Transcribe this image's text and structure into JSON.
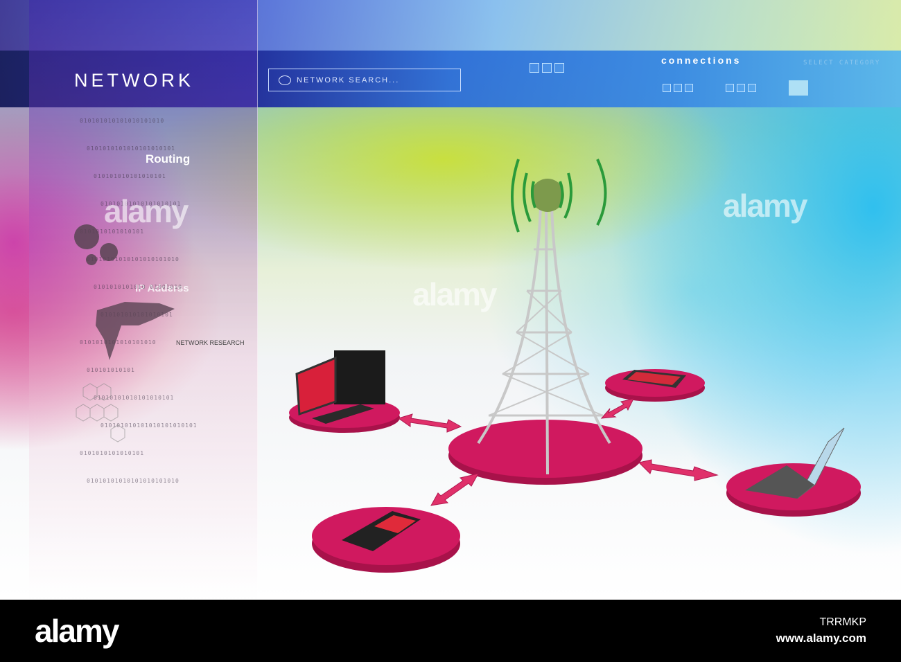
{
  "header": {
    "title": "NETWORK",
    "search_placeholder": "NETWORK SEARCH...",
    "connections_label": "connections",
    "select_category_label": "SELECT CATEGORY"
  },
  "sidebar": {
    "routing_label": "Routing",
    "ip_label": "IP Adderss",
    "research_label": "NETWORK RESEARCH",
    "binary": [
      "010101010101010101010",
      "0101010101010101010101",
      "010101010101010101",
      "01010101010101010101",
      "0101010101010101",
      "01010101010101010101010",
      "0101010101010 01001010",
      "010101010101010101",
      "0101010101010101010",
      "010101010101",
      "01010101010101010101",
      "010101010101010101010101",
      "0101010101010101",
      "01010101010101010101010"
    ]
  },
  "scene": {
    "nodes": [
      "computer",
      "tablet",
      "laptop",
      "mobile-phone"
    ],
    "hub": "cell-tower",
    "disc_color": "#d0195f",
    "arrow_color": "#e0306a"
  },
  "watermark": "alamy",
  "footer": {
    "logo": "alamy",
    "image_id": "TRRMKP",
    "url": "www.alamy.com"
  }
}
